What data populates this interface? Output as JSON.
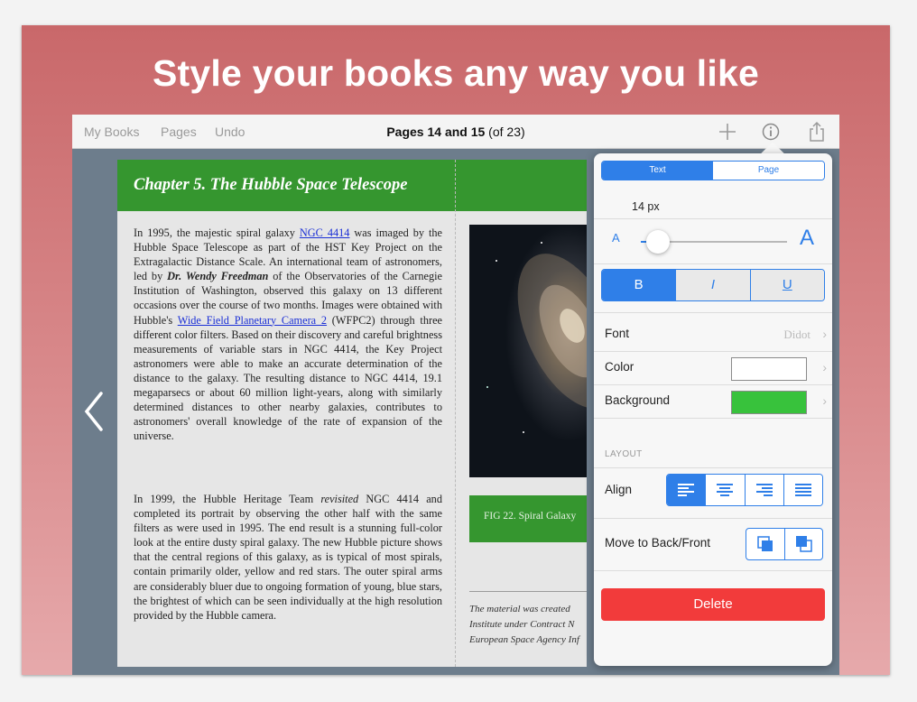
{
  "headline": "Style your books any way you like",
  "toolbar": {
    "my_books": "My Books",
    "pages": "Pages",
    "undo": "Undo",
    "title_bold": "Pages 14 and 15",
    "title_rest": " (of 23)",
    "add_icon": "plus-icon",
    "info_icon": "info-icon",
    "share_icon": "share-icon"
  },
  "book": {
    "chapter_title": "Chapter 5. The Hubble Space Telescope",
    "para1": [
      {
        "t": "In 1995, the majestic spiral galaxy "
      },
      {
        "t": "NGC 4414",
        "link": true
      },
      {
        "t": " was imaged by the Hubble Space Telescope as part of the HST Key Project on the Extragalactic Distance Scale. An international team of astronomers, led by "
      },
      {
        "t": "Dr. Wendy Freedman",
        "bi": true
      },
      {
        "t": " of the Observatories of the Carnegie Institution of Washington, observed this galaxy on 13 different occasions over the course of two months. Images were obtained with Hubble's "
      },
      {
        "t": "Wide Field Planetary Camera 2",
        "link": true
      },
      {
        "t": " (WFPC2) through three different color filters. Based on their discovery and careful brightness measurements of variable stars in NGC 4414, the Key Project astronomers were able to make an accurate determination of the distance to the galaxy. The resulting distance to NGC 4414, 19.1 megaparsecs or about 60 million light-years, along with similarly determined distances to other nearby galaxies, contributes to astronomers' overall knowledge of the rate of expansion of the universe."
      }
    ],
    "para2": [
      {
        "t": "In 1999, the Hubble Heritage Team "
      },
      {
        "t": "revisited",
        "i": true
      },
      {
        "t": " NGC 4414 and completed its portrait by observing the other half with the same filters as were used in 1995. The end result is a stunning full-color look at the entire dusty spiral galaxy. The new Hubble picture shows that the central regions of this galaxy, as is typical of most spirals, contain primarily older, yellow and red stars. The outer spiral arms are considerably bluer due to ongoing formation of young, blue stars, the brightest of which can be seen individually at the high resolution provided by the Hubble camera."
      }
    ],
    "fig_caption": "FIG 22. Spiral Galaxy",
    "credits": [
      "The material was created",
      "Institute under Contract N",
      "European Space Agency Inf"
    ]
  },
  "popover": {
    "tab_text": "Text",
    "tab_page": "Page",
    "size": "14 px",
    "a_small": "A",
    "a_large": "A",
    "slider_value": 0.1,
    "bold": "B",
    "italic": "I",
    "underline": "U",
    "font_label": "Font",
    "font_value": "Didot",
    "color_label": "Color",
    "background_label": "Background",
    "color_value": "#ffffff",
    "background_value": "#38c23c",
    "layout_header": "LAYOUT",
    "align_label": "Align",
    "move_label": "Move to Back/Front",
    "delete": "Delete"
  },
  "colors": {
    "accent": "#2f7fe8",
    "chapter_green": "#35962f",
    "delete_red": "#f23b3b"
  }
}
